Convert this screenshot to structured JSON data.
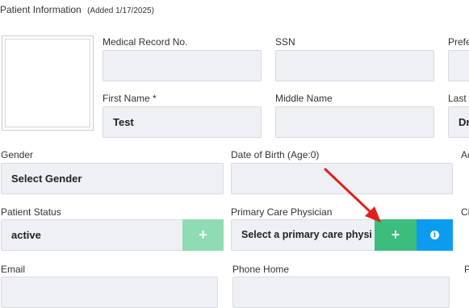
{
  "header": {
    "title": "Patient Information",
    "added": "(Added 1/17/2025)"
  },
  "fields": {
    "mrn": {
      "label": "Medical Record No.",
      "value": ""
    },
    "ssn": {
      "label": "SSN",
      "value": ""
    },
    "preferred": {
      "label": "Prefe",
      "value": ""
    },
    "first_name": {
      "label": "First Name *",
      "value": "Test"
    },
    "middle_name": {
      "label": "Middle Name",
      "value": ""
    },
    "last_name": {
      "label": "Last",
      "value": "Dr"
    },
    "gender": {
      "label": "Gender",
      "value": "Select Gender"
    },
    "dob": {
      "label": "Date of Birth (Age:0)",
      "value": ""
    },
    "col3_row3": {
      "label": "Ac"
    },
    "status": {
      "label": "Patient Status",
      "value": "active"
    },
    "pcp": {
      "label": "Primary Care Physician",
      "value": "Select a primary care physi"
    },
    "col3_row4": {
      "label": "Ci"
    },
    "email": {
      "label": "Email",
      "value": ""
    },
    "phone_home": {
      "label": "Phone Home",
      "value": ""
    },
    "col3_row5": {
      "label": "P"
    }
  },
  "buttons": {
    "status_add": "+",
    "pcp_add": "+",
    "pcp_info": "i"
  },
  "colors": {
    "green": "#3dbd7d",
    "green_disabled": "#8fdcb3",
    "blue": "#0b9cf0",
    "arrow": "#e0201f"
  }
}
